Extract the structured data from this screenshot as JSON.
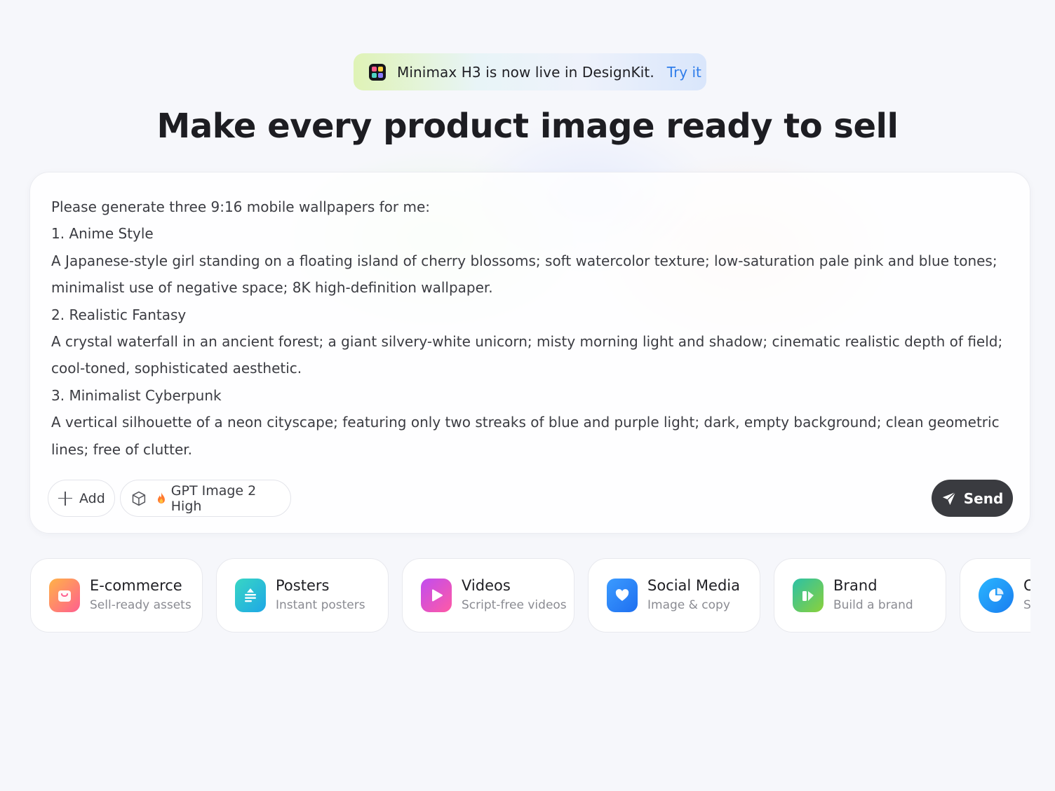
{
  "banner": {
    "text": "Minimax H3 is now live in DesignKit.",
    "link": "Try it"
  },
  "headline": "Make every product image ready to sell",
  "prompt": {
    "lines": [
      "Please generate three 9:16 mobile wallpapers for me:",
      "1. Anime Style",
      "A Japanese-style girl standing on a floating island of cherry blossoms; soft watercolor texture; low-saturation pale pink and blue tones; minimalist use of negative space; 8K high-definition wallpaper.",
      "2. Realistic Fantasy",
      "A crystal waterfall in an ancient forest; a giant silvery-white unicorn; misty morning light and shadow; cinematic realistic depth of field; cool-toned, sophisticated aesthetic.",
      "3. Minimalist Cyberpunk",
      "A vertical silhouette of a neon cityscape; featuring only two streaks of blue and purple light; dark, empty background; clean geometric lines; free of clutter."
    ]
  },
  "toolbar": {
    "add_label": "Add",
    "model_label": "GPT Image 2 High",
    "send_label": "Send"
  },
  "categories": [
    {
      "title": "E-commerce",
      "subtitle": "Sell-ready assets",
      "icon": "shopping-bag-icon"
    },
    {
      "title": "Posters",
      "subtitle": "Instant posters",
      "icon": "poster-icon"
    },
    {
      "title": "Videos",
      "subtitle": "Script-free videos",
      "icon": "play-icon"
    },
    {
      "title": "Social Media",
      "subtitle": "Image & copy",
      "icon": "heart-chat-icon"
    },
    {
      "title": "Brand",
      "subtitle": "Build a brand",
      "icon": "brand-icon"
    },
    {
      "title": "O",
      "subtitle": "St",
      "icon": "pie-chart-icon"
    }
  ],
  "colors": {
    "accent_link": "#2f7dea",
    "send_button": "#3a3b40",
    "background": "#f6f7fb"
  }
}
